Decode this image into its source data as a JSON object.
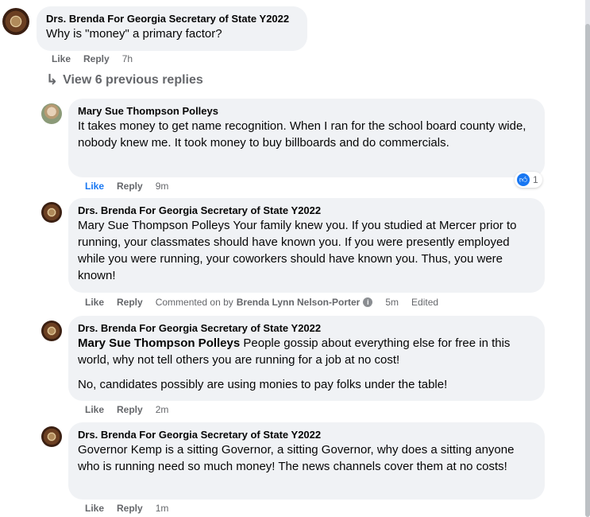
{
  "comments": [
    {
      "author": "Drs. Brenda For Georgia Secretary of State Y2022",
      "text": "Why is \"money\" a primary factor?",
      "like": "Like",
      "reply": "Reply",
      "time": "7h"
    },
    {
      "author": "Mary Sue Thompson Polleys",
      "text": "It takes money to get name recognition. When I ran for the school board county wide, nobody knew me. It took money to buy billboards and do commercials.",
      "like": "Like",
      "reply": "Reply",
      "time": "9m",
      "reaction_count": "1"
    },
    {
      "author": "Drs. Brenda For Georgia Secretary of State Y2022",
      "text": "Mary Sue Thompson Polleys Your family knew you. If you studied at Mercer prior to running, your classmates should have known you. If you were presently employed while you were running, your coworkers should have known you. Thus, you were known!",
      "like": "Like",
      "reply": "Reply",
      "commented_on_by": "Commented on by",
      "commenter": "Brenda Lynn Nelson-Porter",
      "time": "5m",
      "edited": "Edited"
    },
    {
      "author": "Drs. Brenda For Georgia Secretary of State Y2022",
      "mention": "Mary Sue Thompson Polleys",
      "text": " People gossip about everything else for free in this world, why not tell others you are running for a job at no cost!",
      "text2": "No, candidates possibly are using monies to pay folks under the table!",
      "like": "Like",
      "reply": "Reply",
      "time": "2m"
    },
    {
      "author": "Drs. Brenda For Georgia Secretary of State Y2022",
      "text": "Governor Kemp is a sitting Governor, a sitting Governor, why does a sitting anyone who is running need so much money! The news channels cover them at no costs!",
      "like": "Like",
      "reply": "Reply",
      "time": "1m"
    }
  ],
  "view_previous": "View 6 previous replies",
  "icons": {
    "reply_arrow": "reply-arrow-icon",
    "like_reaction": "thumbs-up-icon",
    "info": "info-icon"
  },
  "colors": {
    "bubble": "#f0f2f5",
    "accent": "#1877f2",
    "muted": "#65676b"
  }
}
